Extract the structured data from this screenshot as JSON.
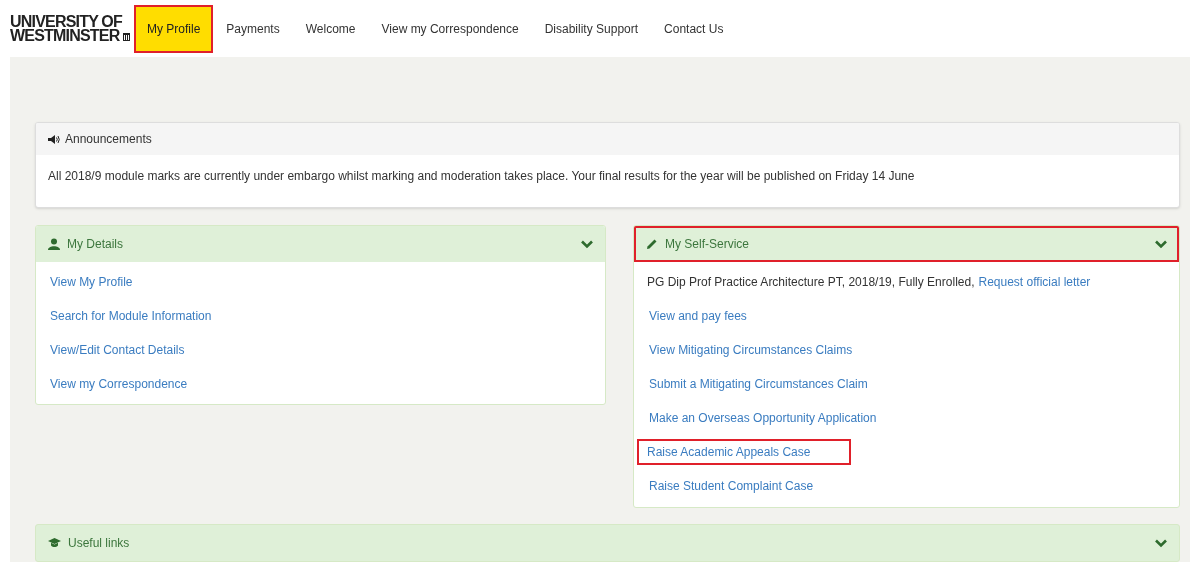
{
  "logo": {
    "line_1": "UNIVERSITY OF",
    "line_2": "WESTMINSTER"
  },
  "nav": [
    {
      "label": "My Profile",
      "selected": true,
      "highlighted": true
    },
    {
      "label": "Payments",
      "selected": false,
      "highlighted": false
    },
    {
      "label": "Welcome",
      "selected": false,
      "highlighted": false
    },
    {
      "label": "View my Correspondence",
      "selected": false,
      "highlighted": false
    },
    {
      "label": "Disability Support",
      "selected": false,
      "highlighted": false
    },
    {
      "label": "Contact Us",
      "selected": false,
      "highlighted": false
    }
  ],
  "announcements": {
    "title": "Announcements",
    "text": "All 2018/9 module marks are currently under embargo whilst marking and moderation takes place. Your final results for the year will be published on Friday 14 June"
  },
  "my_details": {
    "title": "My Details",
    "highlighted": false,
    "links": [
      {
        "label": "View My Profile",
        "highlighted": false
      },
      {
        "label": "Search for Module Information",
        "highlighted": false
      },
      {
        "label": "View/Edit Contact Details",
        "highlighted": false
      },
      {
        "label": "View my Correspondence",
        "highlighted": false
      }
    ]
  },
  "self_service": {
    "title": "My Self-Service",
    "highlighted": true,
    "enrolment": "PG Dip Prof Practice Architecture PT, 2018/19, Fully Enrolled,",
    "enrolment_link": "Request official letter",
    "links": [
      {
        "label": "View and pay fees",
        "highlighted": false
      },
      {
        "label": "View Mitigating Circumstances Claims",
        "highlighted": false
      },
      {
        "label": "Submit a Mitigating Circumstances Claim",
        "highlighted": false
      },
      {
        "label": "Make an Overseas Opportunity Application",
        "highlighted": false
      },
      {
        "label": "Raise Academic Appeals Case",
        "highlighted": true
      },
      {
        "label": "Raise Student Complaint Case",
        "highlighted": false
      }
    ]
  },
  "useful_links": {
    "title": "Useful links"
  }
}
